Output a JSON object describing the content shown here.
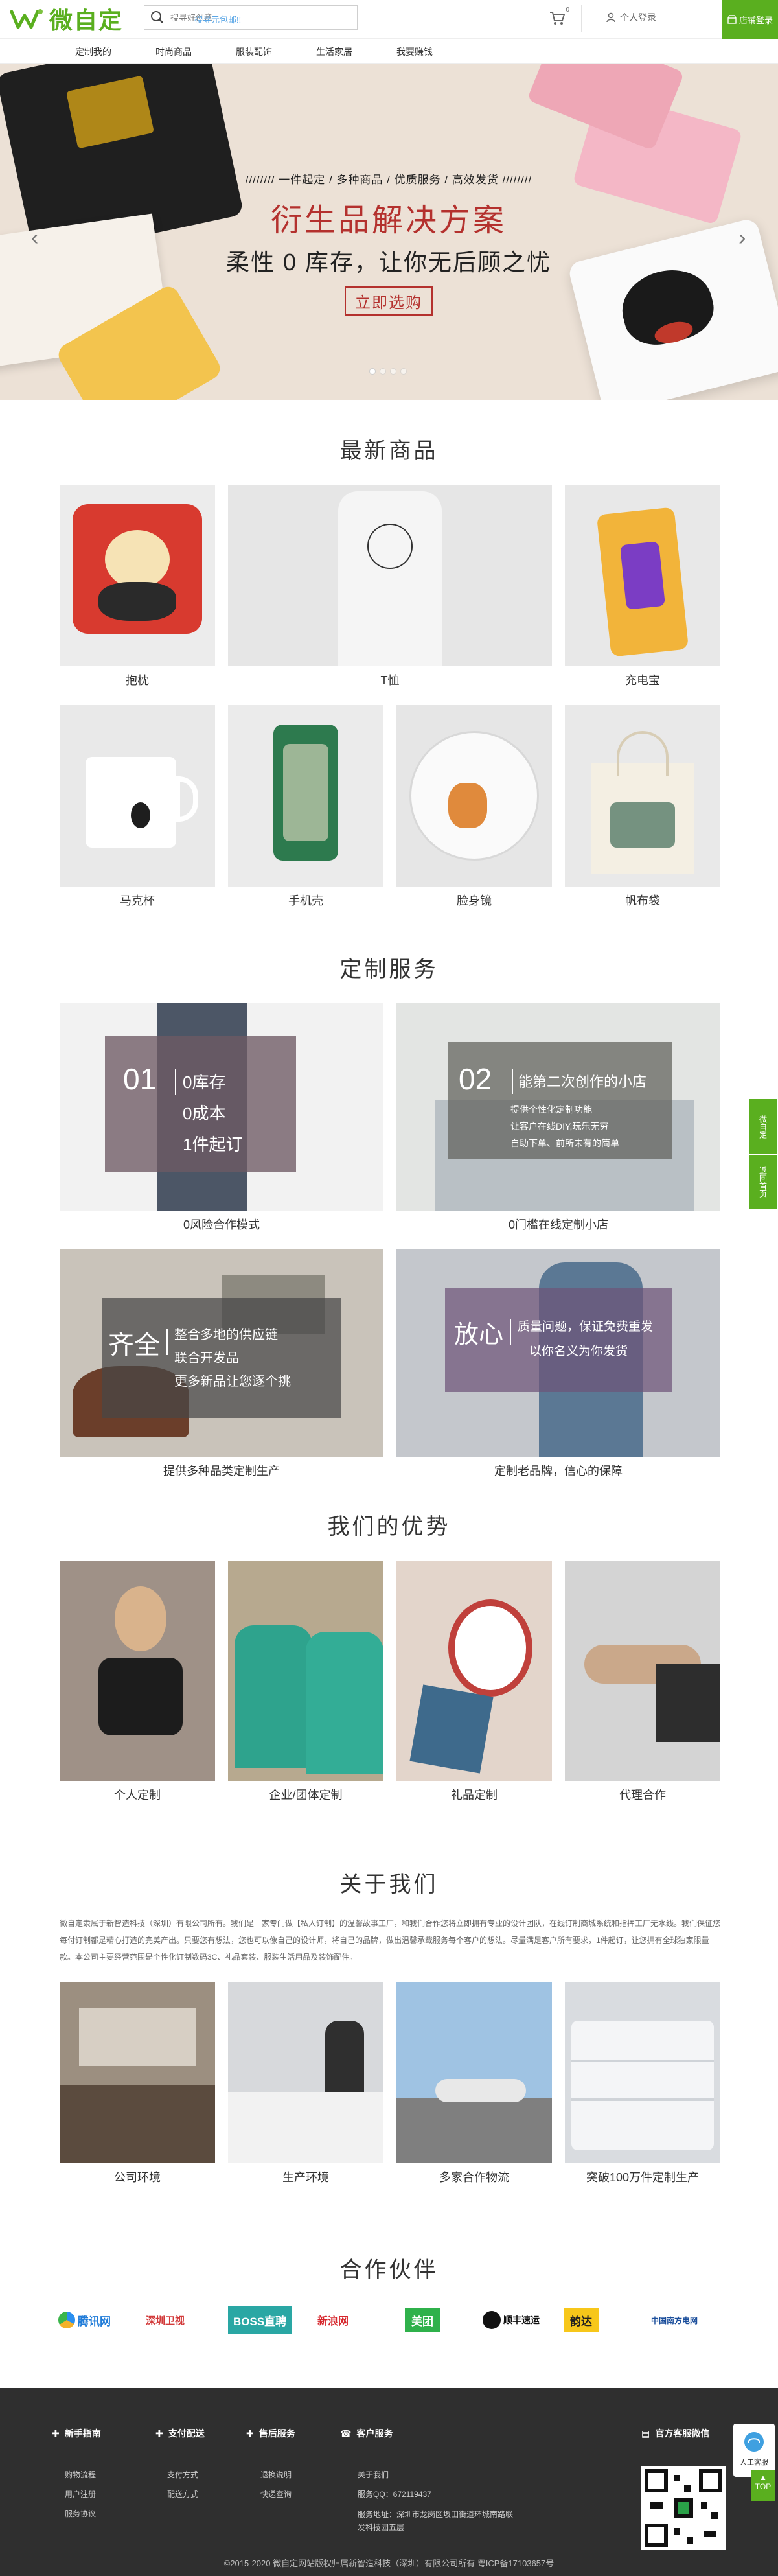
{
  "header": {
    "logo_text": "微自定",
    "search_placeholder": "搜寻好创意",
    "search_hint": "搜寻元包邮!!",
    "cart_count": "0",
    "user_link": "个人登录",
    "login_button": "店铺登录"
  },
  "nav": [
    "定制我的",
    "时尚商品",
    "服装配饰",
    "生活家居",
    "我要赚钱"
  ],
  "hero": {
    "tagline": "//////// 一件起定 / 多种商品 / 优质服务 / 高效发货 ////////",
    "title": "衍生品解决方案",
    "subtitle": "柔性 0 库存，让你无后顾之忧",
    "button": "立即选购"
  },
  "new_products": {
    "title": "最新商品",
    "items": [
      "抱枕",
      "T恤",
      "充电宝",
      "马克杯",
      "手机壳",
      "脸身镜",
      "帆布袋"
    ]
  },
  "services": {
    "title": "定制服务",
    "items": [
      {
        "num": "01",
        "lines": [
          "0库存",
          "0成本",
          "1件起订"
        ],
        "label": "0风险合作模式"
      },
      {
        "num": "02",
        "headline": "能第二次创作的小店",
        "lines": [
          "提供个性化定制功能",
          "让客户在线DIY,玩乐无穷",
          "自助下单、前所未有的简单"
        ],
        "label": "0门槛在线定制小店"
      },
      {
        "headline": "齐全",
        "lines": [
          "整合多地的供应链",
          "联合开发品",
          "更多新品让您逐个挑"
        ],
        "label": "提供多种品类定制生产"
      },
      {
        "headline": "放心",
        "lines": [
          "质量问题，保证免费重发",
          "以你名义为你发货"
        ],
        "label": "定制老品牌，信心的保障"
      }
    ]
  },
  "advantages": {
    "title": "我们的优势",
    "items": [
      "个人定制",
      "企业/团体定制",
      "礼品定制",
      "代理合作"
    ]
  },
  "about": {
    "title": "关于我们",
    "text": "微自定隶属于新智造科技（深圳）有限公司所有。我们是一家专门做【私人订制】的温馨故事工厂，和我们合作您将立即拥有专业的设计团队，在线订制商城系统和指挥工厂无水线。我们保证您每付订制都是精心打造的完美产出。只要您有想法，您也可以像自己的设计师，将自己的品牌，做出温馨承载服务每个客户的想法。尽量满足客户所有要求，1件起订，让您拥有全球独家限量款。本公司主要经营范围是个性化订制数码3C、礼品套装、服装生活用品及装饰配件。",
    "items": [
      "公司环境",
      "生产环境",
      "多家合作物流",
      "突破100万件定制生产"
    ]
  },
  "partners": {
    "title": "合作伙伴",
    "items": [
      "腾讯网",
      "深圳卫视",
      "BOSS直聘",
      "新浪网",
      "美团",
      "顺丰速运",
      "韵达",
      "中国南方电网"
    ]
  },
  "footer": {
    "cols": [
      {
        "head": "新手指南",
        "links": [
          "购物流程",
          "用户注册",
          "服务协议"
        ]
      },
      {
        "head": "支付配送",
        "links": [
          "支付方式",
          "配送方式"
        ]
      },
      {
        "head": "售后服务",
        "links": [
          "退换说明",
          "快递查询"
        ]
      },
      {
        "head": "客户服务",
        "links": [
          "关于我们",
          "服务QQ：672119437",
          "服务地址：深圳市龙岗区坂田街道环城南路联发科技园五层"
        ]
      },
      {
        "head": "官方客服微信",
        "links": []
      }
    ],
    "copyright": "©2015-2020 微自定网站版权归属新智造科技（深圳）有限公司所有  粤ICP备17103657号"
  },
  "side": {
    "service": "人工客服",
    "top": "TOP"
  },
  "side_tabs": [
    "微自定",
    "返回首页"
  ],
  "colors": {
    "brand": "#5aaf1f",
    "accent": "#b4312e",
    "footer": "#2f2f2f"
  }
}
